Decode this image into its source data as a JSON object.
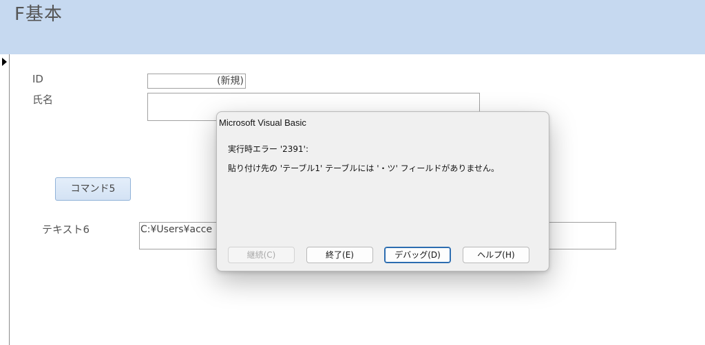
{
  "form": {
    "title": "F基本",
    "id_label": "ID",
    "id_value": "(新規)",
    "name_label": "氏名",
    "name_value": "",
    "command_button": "コマンド5",
    "text_label": "テキスト6",
    "text_value": "C:¥Users¥acce"
  },
  "dialog": {
    "title": "Microsoft Visual Basic",
    "line1": "実行時エラー '2391':",
    "line2": "貼り付け先の 'テーブル1' テーブルには '・ツ' フィールドがありません。",
    "buttons": {
      "continue": "継続(C)",
      "end": "終了(E)",
      "debug": "デバッグ(D)",
      "help": "ヘルプ(H)"
    }
  }
}
